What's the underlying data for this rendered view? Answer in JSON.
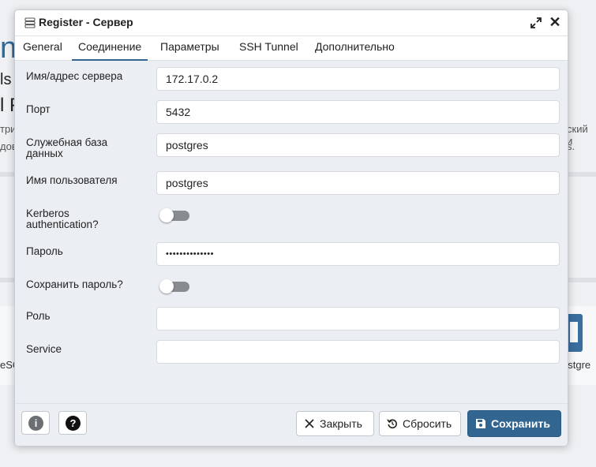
{
  "background": {
    "logo_fragment": "n",
    "line_ls": "ls",
    "line_p": "l P",
    "left_text_1": "три",
    "left_text_2": "дов",
    "right_text_1": "ский и",
    "right_text_2": "s.",
    "card_left": "eSQ",
    "card_right": "ostgre"
  },
  "dialog": {
    "title": "Register - Сервер",
    "tabs": [
      "General",
      "Соединение",
      "Параметры",
      "SSH Tunnel",
      "Дополнительно"
    ],
    "active_tab": "Соединение",
    "fields": {
      "host_label": "Имя/адрес сервера",
      "host_value": "172.17.0.2",
      "port_label": "Порт",
      "port_value": "5432",
      "maintenance_db_label_1": "Служебная база",
      "maintenance_db_label_2": "данных",
      "maintenance_db_value": "postgres",
      "username_label": "Имя пользователя",
      "username_value": "postgres",
      "kerberos_label_1": "Kerberos",
      "kerberos_label_2": "authentication?",
      "kerberos_enabled": false,
      "password_label": "Пароль",
      "password_value": "••••••••••••••",
      "save_password_label": "Сохранить пароль?",
      "save_password_enabled": false,
      "role_label": "Роль",
      "role_value": "",
      "service_label": "Service",
      "service_value": ""
    },
    "footer": {
      "info_icon": "info-icon",
      "help_icon": "help-icon",
      "close_label": "Закрыть",
      "reset_label": "Сбросить",
      "save_label": "Сохранить"
    },
    "colors": {
      "primary": "#326690",
      "toggle_off": "#888c91",
      "dialog_bg": "#ebeef2"
    }
  }
}
